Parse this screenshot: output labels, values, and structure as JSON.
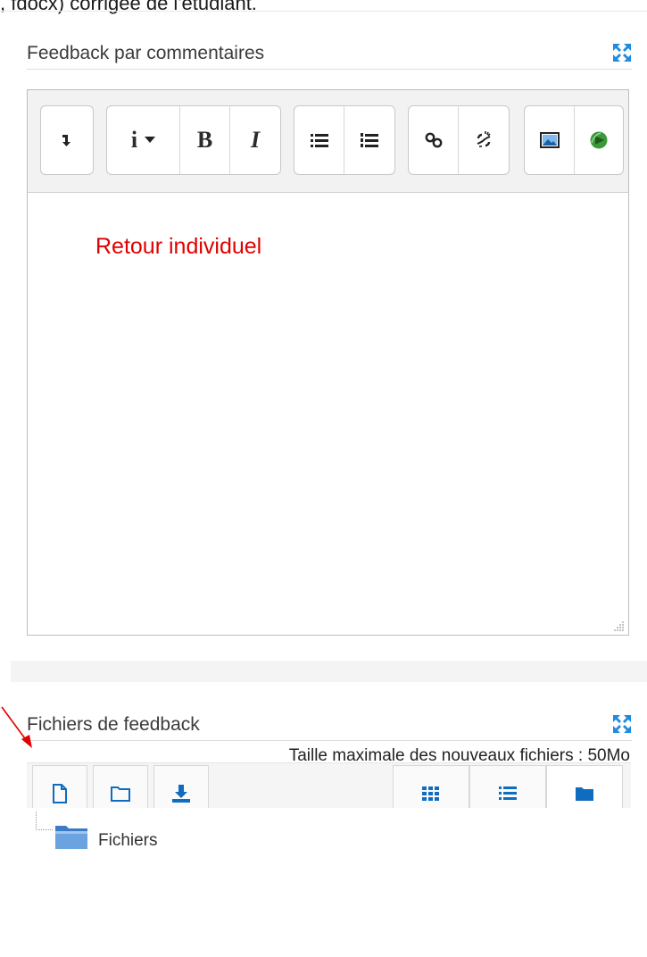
{
  "page": {
    "top_text": ", fdocx) corrigée de l'étudiant."
  },
  "feedback_comments": {
    "title": "Feedback par commentaires",
    "content_text": "Retour individuel",
    "toolbar": [
      {
        "group": "toggle",
        "buttons": [
          {
            "name": "show-more-buttons",
            "icon": "arrow-down-icon"
          }
        ]
      },
      {
        "group": "style",
        "buttons": [
          {
            "name": "paragraph-styles",
            "label": "i",
            "icon": "chevron-down-icon"
          },
          {
            "name": "bold",
            "label": "B"
          },
          {
            "name": "italic",
            "label": "I"
          }
        ]
      },
      {
        "group": "list",
        "buttons": [
          {
            "name": "unordered-list",
            "icon": "bullet-list-icon"
          },
          {
            "name": "ordered-list",
            "icon": "numbered-list-icon"
          }
        ]
      },
      {
        "group": "links",
        "buttons": [
          {
            "name": "link",
            "icon": "link-icon"
          },
          {
            "name": "unlink",
            "icon": "unlink-icon"
          }
        ]
      },
      {
        "group": "files",
        "buttons": [
          {
            "name": "insert-image",
            "icon": "image-icon"
          },
          {
            "name": "insert-media",
            "icon": "media-icon"
          }
        ]
      }
    ]
  },
  "feedback_files": {
    "title": "Fichiers de feedback",
    "max_size": "Taille maximale des nouveaux fichiers : 50Mo",
    "folder_label": "Fichiers",
    "buttons_left": [
      "add-file-icon",
      "create-folder-icon",
      "download-icon"
    ],
    "buttons_right": [
      "grid-view-icon",
      "list-view-icon",
      "folder-view-icon"
    ]
  },
  "colors": {
    "accent_blue": "#0f6cbf",
    "content_red": "#e00000",
    "annotation_arrow": "#e00000"
  }
}
